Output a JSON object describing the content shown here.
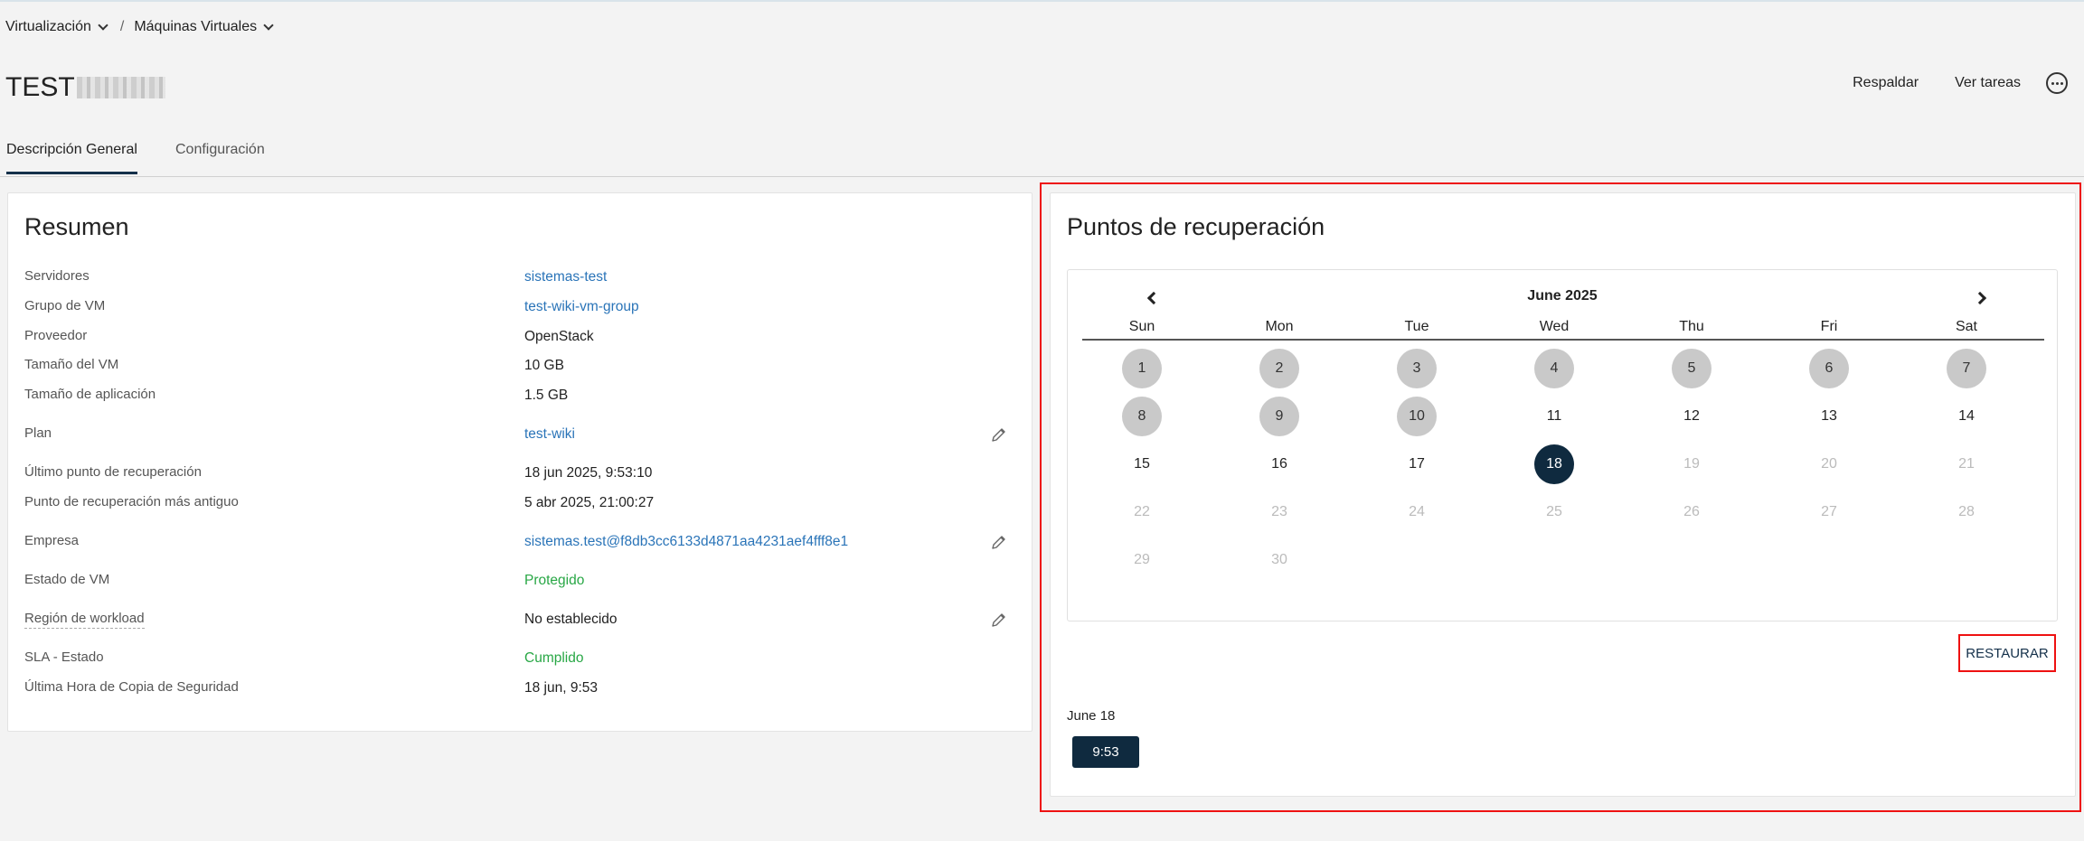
{
  "breadcrumb": {
    "items": [
      {
        "label": "Virtualización"
      },
      {
        "label": "Máquinas Virtuales"
      }
    ],
    "separator": "/"
  },
  "page": {
    "title": "TEST"
  },
  "header_actions": {
    "backup_label": "Respaldar",
    "tasks_label": "Ver tareas"
  },
  "tabs": [
    {
      "label": "Descripción General",
      "active": true
    },
    {
      "label": "Configuración",
      "active": false
    }
  ],
  "summary": {
    "title": "Resumen",
    "rows": [
      {
        "label": "Servidores",
        "value": "sistemas-test"
      },
      {
        "label": "Grupo de VM",
        "value": "test-wiki-vm-group"
      },
      {
        "label": "Proveedor",
        "value": "OpenStack"
      },
      {
        "label": "Tamaño del VM",
        "value": "10 GB"
      },
      {
        "label": "Tamaño de aplicación",
        "value": "1.5 GB"
      },
      {
        "label": "Plan",
        "value": "test-wiki"
      },
      {
        "label": "Último punto de recuperación",
        "value": "18 jun 2025, 9:53:10"
      },
      {
        "label": "Punto de recuperación más antiguo",
        "value": "5 abr 2025, 21:00:27"
      },
      {
        "label": "Empresa",
        "value": "sistemas.test@f8db3cc6133d4871aa4231aef4fff8e1"
      },
      {
        "label": "Estado de VM",
        "value": "Protegido"
      },
      {
        "label": "Región de workload",
        "value": "No establecido"
      },
      {
        "label": "SLA - Estado",
        "value": "Cumplido"
      },
      {
        "label": "Última Hora de Copia de Seguridad",
        "value": "18 jun, 9:53"
      }
    ]
  },
  "recovery": {
    "title": "Puntos de recuperación",
    "calendar": {
      "month_label": "June 2025",
      "weekdays": [
        "Sun",
        "Mon",
        "Tue",
        "Wed",
        "Thu",
        "Fri",
        "Sat"
      ],
      "days": [
        [
          "1",
          "2",
          "3",
          "4",
          "5",
          "6",
          "7"
        ],
        [
          "8",
          "9",
          "10",
          "11",
          "12",
          "13",
          "14"
        ],
        [
          "15",
          "16",
          "17",
          "18",
          "19",
          "20",
          "21"
        ],
        [
          "22",
          "23",
          "24",
          "25",
          "26",
          "27",
          "28"
        ],
        [
          "29",
          "30"
        ]
      ],
      "days_with_points": [
        "1",
        "2",
        "3",
        "4",
        "5",
        "6",
        "7",
        "8",
        "9",
        "10"
      ],
      "selected_day": "18",
      "last_enabled_day": "18"
    },
    "restore_label": "RESTAURAR",
    "selected_date_label": "June 18",
    "times": [
      "9:53"
    ]
  },
  "colors": {
    "accent": "#0f2a3f",
    "link": "#2a74b8",
    "success": "#28a745",
    "highlight": "#ee1111"
  }
}
